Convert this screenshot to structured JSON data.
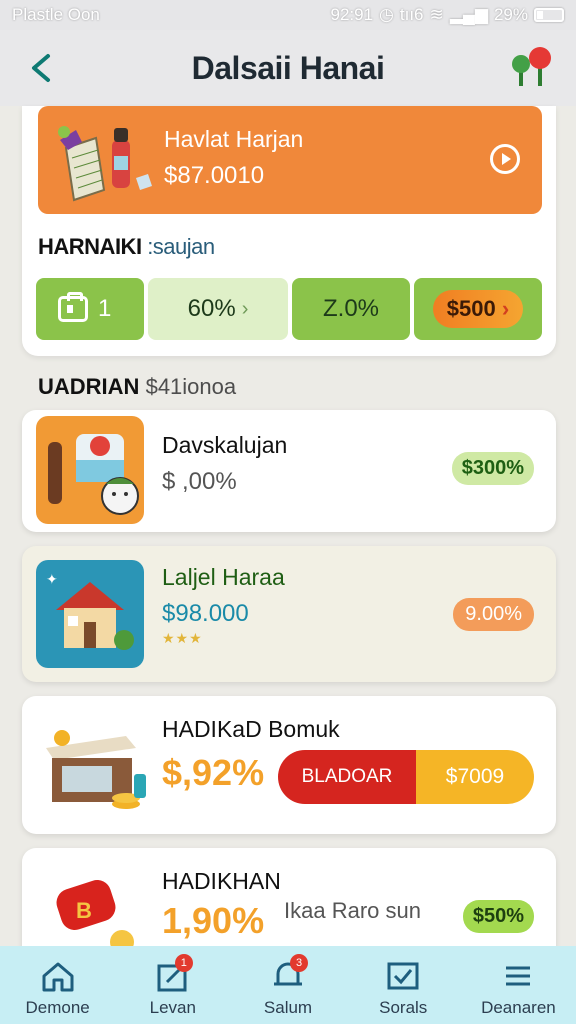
{
  "status_bar": {
    "carrier": "Plastle Oon",
    "time": "92:91",
    "signal_text": "tıı6",
    "battery": "29%"
  },
  "header": {
    "title": "Dalsaii Hanai"
  },
  "banner": {
    "title": "Havlat Harjan",
    "amount": "$87.0010"
  },
  "section1": {
    "title": "HARNAIKI",
    "subtitle": ":saujan"
  },
  "chips": [
    {
      "label": "1"
    },
    {
      "label": "60%"
    },
    {
      "label": "Z.0%"
    },
    {
      "label": "$500"
    }
  ],
  "section2": {
    "title": "UADRIAN",
    "subtitle": "$41ionoa"
  },
  "cards": [
    {
      "name": "Davskalujan",
      "price": "$ ,00%",
      "badge": "$300%"
    },
    {
      "name": "Laljel Haraa",
      "price": "$98.000",
      "badge": "9.00%"
    },
    {
      "name": "HADIKaD Bomuk",
      "price": "$,92%",
      "buy_left": "BLADOAR",
      "buy_right": "$7009"
    },
    {
      "name": "HADIKHAN",
      "price": "1,90%",
      "subtitle": "Ikaa Raro sun",
      "badge": "$50%"
    }
  ],
  "bottom_nav": [
    {
      "label": "Demone",
      "icon": "home-icon"
    },
    {
      "label": "Levan",
      "icon": "edit-icon",
      "badge": "1"
    },
    {
      "label": "Salum",
      "icon": "bell-icon",
      "badge": "3"
    },
    {
      "label": "Sorals",
      "icon": "check-icon"
    },
    {
      "label": "Deanaren",
      "icon": "menu-icon"
    }
  ],
  "colors": {
    "accent_orange": "#f0883a",
    "accent_green": "#8bc34a",
    "nav_bg": "#c7eef4"
  }
}
